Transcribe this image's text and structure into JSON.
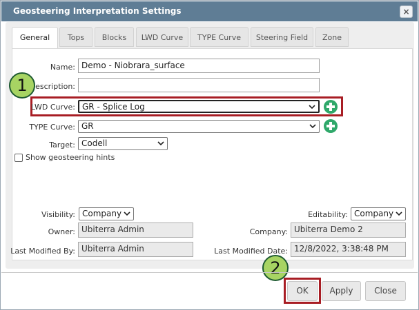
{
  "dialog": {
    "title": "Geosteering Interpretation Settings",
    "close_label": "×"
  },
  "tabs": [
    {
      "label": "General",
      "active": true
    },
    {
      "label": "Tops"
    },
    {
      "label": "Blocks"
    },
    {
      "label": "LWD Curve"
    },
    {
      "label": "TYPE Curve"
    },
    {
      "label": "Steering Field"
    },
    {
      "label": "Zone"
    }
  ],
  "form": {
    "name_label": "Name:",
    "name_value": "Demo - Niobrara_surface",
    "description_label": "Description:",
    "description_value": "",
    "lwd_curve_label": "LWD Curve:",
    "lwd_curve_value": "GR - Splice Log",
    "type_curve_label": "TYPE Curve:",
    "type_curve_value": "GR",
    "target_label": "Target:",
    "target_value": "Codell",
    "hints_label": "Show geosteering hints",
    "hints_checked": false,
    "visibility_label": "Visibility:",
    "visibility_value": "Company",
    "editability_label": "Editability:",
    "editability_value": "Company",
    "owner_label": "Owner:",
    "owner_value": "Ubiterra Admin",
    "company_label": "Company:",
    "company_value": "Ubiterra Demo 2",
    "modified_by_label": "Last Modified By:",
    "modified_by_value": "Ubiterra Admin",
    "modified_date_label": "Last Modified Date:",
    "modified_date_value": "12/8/2022, 3:38:48 PM"
  },
  "annotations": {
    "step1": "1",
    "step2": "2",
    "highlight_color": "#a81d24",
    "badge_color": "#a7d463"
  },
  "buttons": {
    "ok": "OK",
    "apply": "Apply",
    "close": "Close"
  },
  "colors": {
    "titlebar": "#5f7d95",
    "add_icon": "#2fa86a"
  },
  "icons": [
    "close-icon",
    "chevron-down-icon",
    "add-icon"
  ]
}
